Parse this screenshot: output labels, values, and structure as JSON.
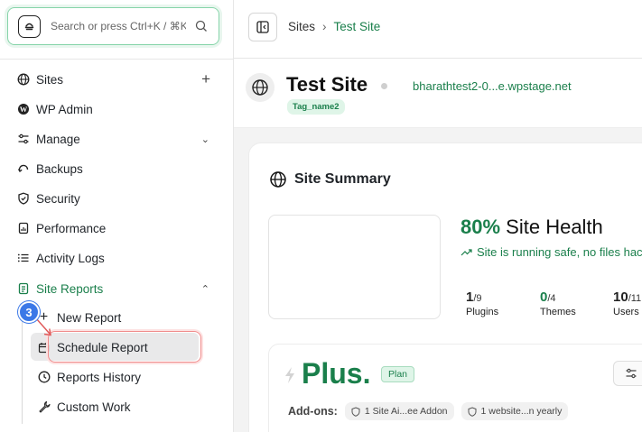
{
  "search": {
    "placeholder": "Search or press Ctrl+K / ⌘K"
  },
  "sidebar": {
    "items": [
      {
        "label": "Sites",
        "right": "+"
      },
      {
        "label": "WP Admin"
      },
      {
        "label": "Manage",
        "right": "⌄"
      },
      {
        "label": "Backups"
      },
      {
        "label": "Security"
      },
      {
        "label": "Performance"
      },
      {
        "label": "Activity Logs"
      },
      {
        "label": "Site Reports",
        "right": "⌃"
      }
    ],
    "sub_items": [
      {
        "label": "New Report"
      },
      {
        "label": "Schedule Report"
      },
      {
        "label": "Reports History"
      },
      {
        "label": "Custom Work"
      }
    ],
    "step_badge": "3"
  },
  "header": {
    "breadcrumb": [
      "Sites",
      "›",
      "Test Site"
    ]
  },
  "site": {
    "title": "Test Site",
    "url": "bharathtest2-0...e.wpstage.net",
    "tag": "Tag_name2"
  },
  "summary": {
    "title": "Site Summary",
    "health_percent": "80%",
    "health_label": "Site Health",
    "health_sub": "Site is running safe, no files hac",
    "stats": [
      {
        "value": "1",
        "total": "/9",
        "label": "Plugins",
        "accent": false
      },
      {
        "value": "0",
        "total": "/4",
        "label": "Themes",
        "accent": true
      },
      {
        "value": "10",
        "total": "/11",
        "label": "Users",
        "accent": false
      }
    ]
  },
  "plan": {
    "name": "Plus.",
    "badge": "Plan",
    "addons_label": "Add-ons:",
    "addons": [
      "1 Site Ai...ee Addon",
      "1 website...n yearly"
    ]
  },
  "colors": {
    "accent": "#1a7f4b",
    "highlight": "#f08c8c",
    "badge": "#3b78e7"
  }
}
